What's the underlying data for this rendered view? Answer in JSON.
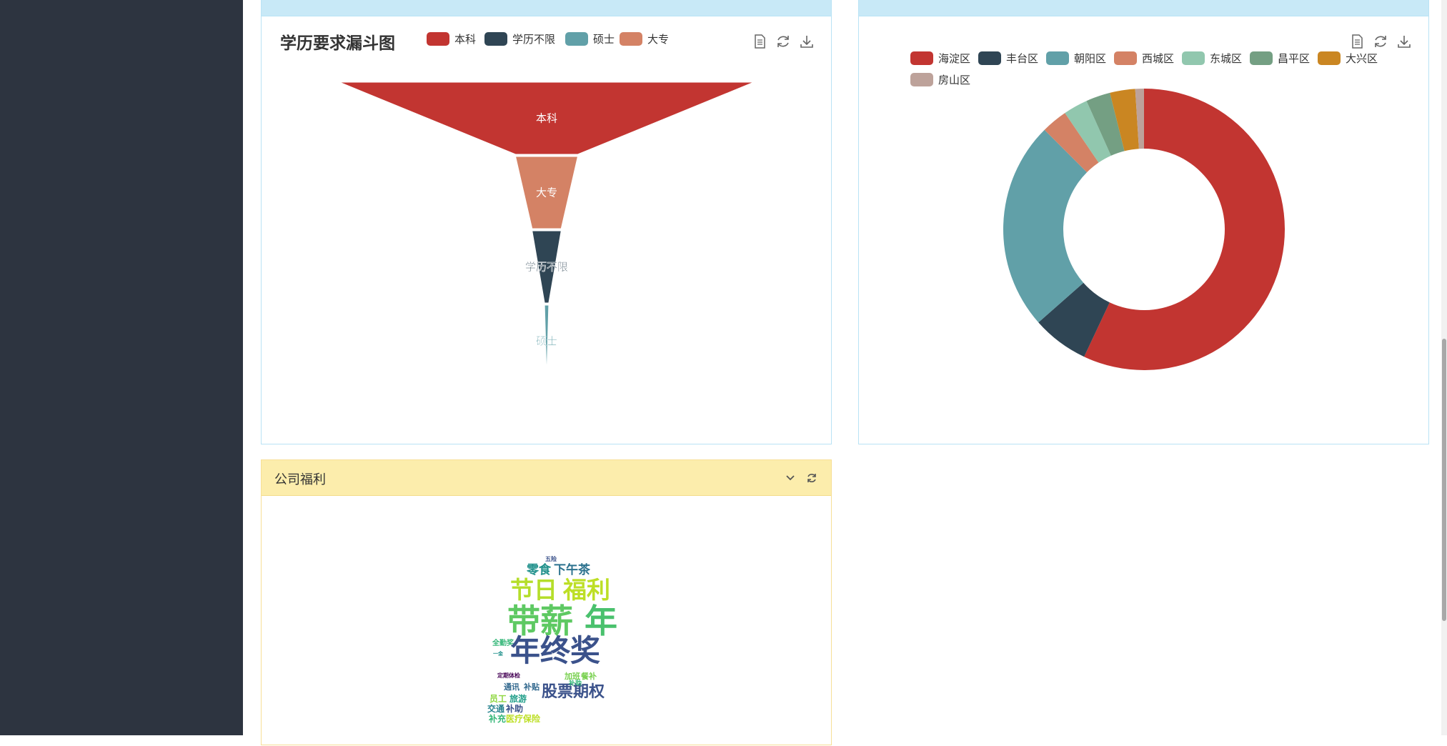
{
  "education_panel": {
    "chart_data": {
      "type": "funnel",
      "title": "学历要求漏斗图",
      "legend": [
        {
          "label": "本科",
          "color": "#c23531"
        },
        {
          "label": "学历不限",
          "color": "#2f4554"
        },
        {
          "label": "硕士",
          "color": "#61a0a8"
        },
        {
          "label": "大专",
          "color": "#d48265"
        }
      ],
      "categories": [
        "本科",
        "大专",
        "学历不限",
        "硕士"
      ],
      "values": [
        100,
        15,
        7,
        1
      ],
      "colors": [
        "#c23531",
        "#d48265",
        "#2f4554",
        "#61a0a8"
      ],
      "legend_position": "top"
    },
    "toolbox": [
      "data-view-icon",
      "restore-icon",
      "save-image-icon"
    ]
  },
  "district_panel": {
    "chart_data": {
      "type": "pie",
      "subtype": "donut",
      "categories": [
        "海淀区",
        "丰台区",
        "朝阳区",
        "西城区",
        "东城区",
        "昌平区",
        "大兴区",
        "房山区"
      ],
      "values": [
        57,
        6.5,
        24,
        3,
        2.8,
        2.8,
        2.9,
        1
      ],
      "colors": [
        "#c23531",
        "#2f4554",
        "#61a0a8",
        "#d48265",
        "#91c7ae",
        "#749f83",
        "#ca8622",
        "#bda29a"
      ],
      "legend_position": "top"
    },
    "toolbox": [
      "data-view-icon",
      "restore-icon",
      "save-image-icon"
    ]
  },
  "welfare_panel": {
    "title": "公司福利",
    "header_icons": [
      "collapse-chevron-icon",
      "refresh-icon"
    ],
    "wordcloud": {
      "large_words": [
        "年终奖",
        "带薪",
        "年",
        "节日",
        "福利"
      ],
      "medium_words": [
        "零食",
        "下午茶",
        "员工",
        "旅游",
        "交通",
        "补助",
        "补充",
        "医疗保险",
        "通讯",
        "补贴",
        "餐补",
        "加班",
        "补助",
        "全勤奖",
        "定期体检",
        "五险",
        "一金",
        "股票期权"
      ]
    }
  },
  "colors": {
    "sidebar": "#2d3440",
    "blue_header": "#c8e9f7",
    "yellow_header": "#fcedac"
  }
}
